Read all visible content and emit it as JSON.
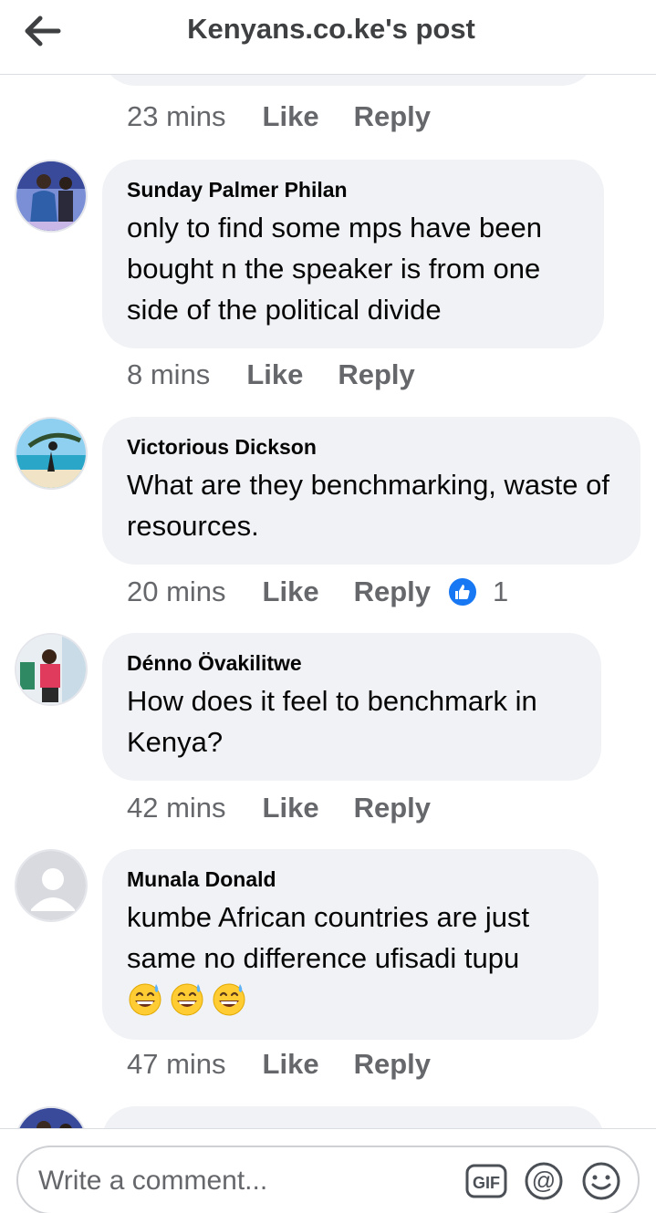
{
  "header": {
    "title": "Kenyans.co.ke's post"
  },
  "previous": {
    "time": "23 mins",
    "like": "Like",
    "reply": "Reply"
  },
  "comments": [
    {
      "author": "Sunday Palmer Philan",
      "text": "only to find some mps have been bought n the speaker is from one side of the political divide",
      "time": "8 mins",
      "like": "Like",
      "reply": "Reply"
    },
    {
      "author": "Victorious Dickson",
      "text": "What are they benchmarking, waste of resources.",
      "time": "20 mins",
      "like": "Like",
      "reply": "Reply",
      "reactions": {
        "icon": "thumbs-up-icon",
        "count": "1",
        "color": "#1877f2"
      }
    },
    {
      "author": "Dénno Övakilitwe",
      "text": "How does it feel to benchmark in Kenya?",
      "time": "42 mins",
      "like": "Like",
      "reply": "Reply"
    },
    {
      "author": "Munala Donald",
      "text": "kumbe African countries are just same no difference ufisadi tupu",
      "emoji": [
        "grinning-sweat-emoji",
        "grinning-sweat-emoji",
        "grinning-sweat-emoji"
      ],
      "time": "47 mins",
      "like": "Like",
      "reply": "Reply"
    }
  ],
  "composer": {
    "placeholder": "Write a comment...",
    "icons": [
      "gif-icon",
      "at-mention-icon",
      "smiley-icon"
    ]
  },
  "colors": {
    "bubble": "#f0f2f5",
    "muted": "#65676b",
    "accent": "#1877f2"
  }
}
